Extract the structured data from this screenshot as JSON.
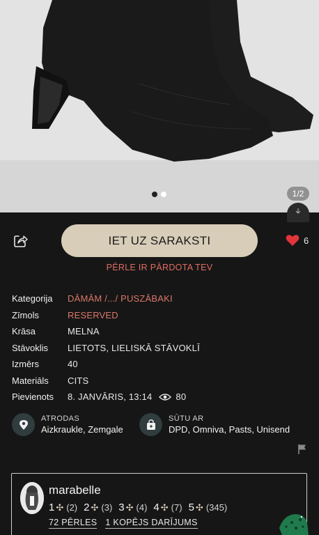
{
  "gallery": {
    "counter": "1/2",
    "dots": 2,
    "active_dot": 0
  },
  "actions": {
    "go_button": "IET UZ SARAKSTI",
    "likes": "6",
    "sold_notice": "PĒRLE IR PĀRDOTA TEV"
  },
  "details": [
    {
      "label": "Kategorija",
      "value": "DĀMĀM /.../ PUSZĀBAKI",
      "link": true
    },
    {
      "label": "Zīmols",
      "value": "RESERVED",
      "link": true
    },
    {
      "label": "Krāsa",
      "value": "MELNA",
      "link": false
    },
    {
      "label": "Stāvoklis",
      "value": "LIETOTS, LIELISKĀ STĀVOKLĪ",
      "link": false
    },
    {
      "label": "Izmērs",
      "value": "40",
      "link": false
    },
    {
      "label": "Materiāls",
      "value": "CITS",
      "link": false
    },
    {
      "label": "Pievienots",
      "value": "8. JANVĀRIS, 13:14",
      "link": false,
      "views": "80"
    }
  ],
  "location": {
    "label": "ATRODAS",
    "value": "Aizkraukle, Zemgale"
  },
  "shipping": {
    "label": "SŪTU AR",
    "value": "DPD, Omniva, Pasts, Unisend"
  },
  "seller": {
    "name": "marabelle",
    "ratings": [
      {
        "stars": "1",
        "count": "(2)"
      },
      {
        "stars": "2",
        "count": "(3)"
      },
      {
        "stars": "3",
        "count": "(4)"
      },
      {
        "stars": "4",
        "count": "(7)"
      },
      {
        "stars": "5",
        "count": "(345)"
      }
    ],
    "pearls": "72 PĒRLES",
    "deals": "1 KOPĒJS DARĪJUMS"
  },
  "colors": {
    "accent_beige": "#d8cdb8",
    "link_red": "#d9786b",
    "heart_red": "#e0353a",
    "background": "#161616"
  }
}
